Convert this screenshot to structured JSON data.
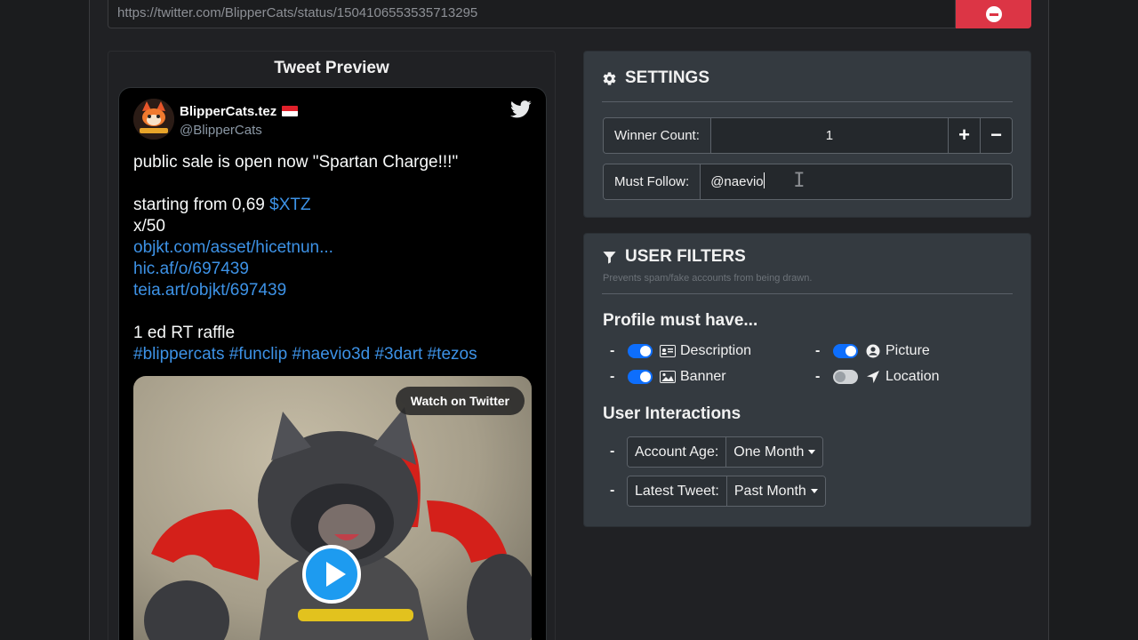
{
  "url_bar": {
    "value": "https://twitter.com/BlipperCats/status/1504106553535713295"
  },
  "preview": {
    "title": "Tweet Preview",
    "tweet": {
      "name": "BlipperCats.tez",
      "handle": "@BlipperCats",
      "lines": [
        {
          "text": "public sale is open now \"Spartan Charge!!!\""
        },
        {
          "text": ""
        },
        {
          "text": "starting from 0,69 ",
          "link": "$XTZ"
        },
        {
          "text": "x/50"
        },
        {
          "link": "objkt.com/asset/hicetnun..."
        },
        {
          "link": "hic.af/o/697439"
        },
        {
          "link": "teia.art/objkt/697439"
        },
        {
          "text": ""
        },
        {
          "text": "1 ed RT raffle"
        },
        {
          "link": "#blippercats #funclip #naevio3d #3dart #tezos"
        }
      ],
      "watch_label": "Watch on Twitter"
    }
  },
  "settings": {
    "title": "SETTINGS",
    "winner_count_label": "Winner Count:",
    "winner_count_value": "1",
    "plus": "+",
    "minus": "−",
    "must_follow_label": "Must Follow:",
    "must_follow_value": "@naevio"
  },
  "filters": {
    "title": "USER FILTERS",
    "subtitle": "Prevents spam/fake accounts from being drawn.",
    "profile_heading": "Profile must have...",
    "profile_items": [
      {
        "label": "Description",
        "enabled": true,
        "icon": "id-card-icon"
      },
      {
        "label": "Picture",
        "enabled": true,
        "icon": "user-circle-icon"
      },
      {
        "label": "Banner",
        "enabled": true,
        "icon": "image-icon"
      },
      {
        "label": "Location",
        "enabled": false,
        "icon": "location-arrow-icon"
      }
    ],
    "interactions_heading": "User Interactions",
    "account_age_label": "Account Age:",
    "account_age_value": "One Month",
    "latest_tweet_label": "Latest Tweet:",
    "latest_tweet_value": "Past Month",
    "dash": "-"
  },
  "colors": {
    "accent": "#0d6efd",
    "danger": "#dc3545",
    "link": "#3d92e6"
  }
}
